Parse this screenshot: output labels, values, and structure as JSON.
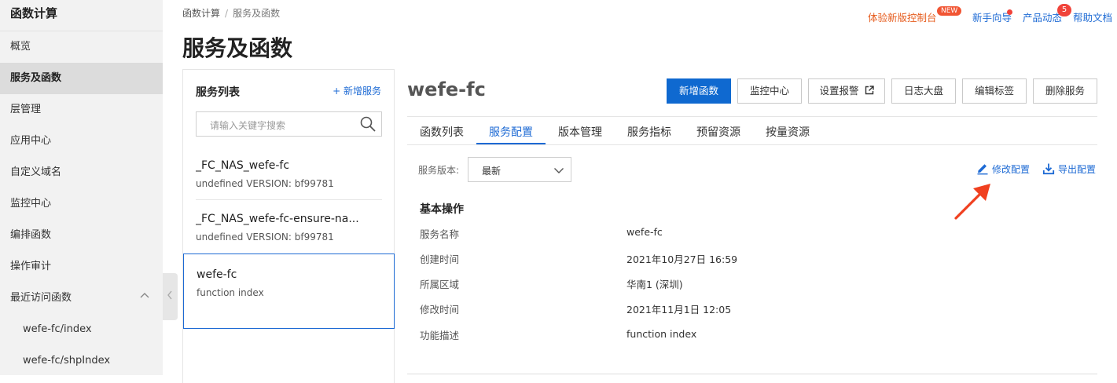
{
  "sidebar": {
    "title": "函数计算",
    "items": [
      {
        "label": "概览"
      },
      {
        "label": "服务及函数"
      },
      {
        "label": "层管理"
      },
      {
        "label": "应用中心"
      },
      {
        "label": "自定义域名"
      },
      {
        "label": "监控中心"
      },
      {
        "label": "编排函数"
      },
      {
        "label": "操作审计"
      },
      {
        "label": "最近访问函数"
      }
    ],
    "recent": [
      "wefe-fc/index",
      "wefe-fc/shpIndex"
    ],
    "active_index": 1
  },
  "breadcrumb": {
    "root": "函数计算",
    "sep": "/",
    "current": "服务及函数"
  },
  "page_title": "服务及函数",
  "toplinks": {
    "new_console": "体验新版控制台",
    "new_badge": "NEW",
    "guide": "新手向导",
    "news": "产品动态",
    "news_count": "5",
    "help": "帮助文档"
  },
  "service_list": {
    "title": "服务列表",
    "add_label": "+ 新增服务",
    "search_placeholder": "请输入关键字搜索",
    "items": [
      {
        "name": "_FC_NAS_wefe-fc",
        "sub": "undefined VERSION: bf99781"
      },
      {
        "name": "_FC_NAS_wefe-fc-ensure-na...",
        "sub": "undefined VERSION: bf99781"
      },
      {
        "name": "wefe-fc",
        "sub": "function index"
      }
    ]
  },
  "detail": {
    "title": "wefe-fc",
    "buttons": {
      "new_function": "新增函数",
      "monitor": "监控中心",
      "alarm": "设置报警",
      "log": "日志大盘",
      "tags": "编辑标签",
      "delete": "删除服务"
    },
    "tabs": [
      "函数列表",
      "服务配置",
      "版本管理",
      "服务指标",
      "预留资源",
      "按量资源"
    ],
    "active_tab": 1,
    "version_label": "服务版本:",
    "version_value": "最新",
    "edit_config": "修改配置",
    "export_config": "导出配置",
    "section_title": "基本操作",
    "fields": [
      {
        "k": "服务名称",
        "v": "wefe-fc"
      },
      {
        "k": "创建时间",
        "v": "2021年10月27日 16:59"
      },
      {
        "k": "所属区域",
        "v": "华南1 (深圳)"
      },
      {
        "k": "修改时间",
        "v": "2021年11月1日 12:05"
      },
      {
        "k": "功能描述",
        "v": "function index"
      }
    ]
  },
  "colors": {
    "accent": "#1d6ad4",
    "primary_button": "#0f69d0",
    "arrow": "#f0401f",
    "new_link": "#e65b1c"
  }
}
